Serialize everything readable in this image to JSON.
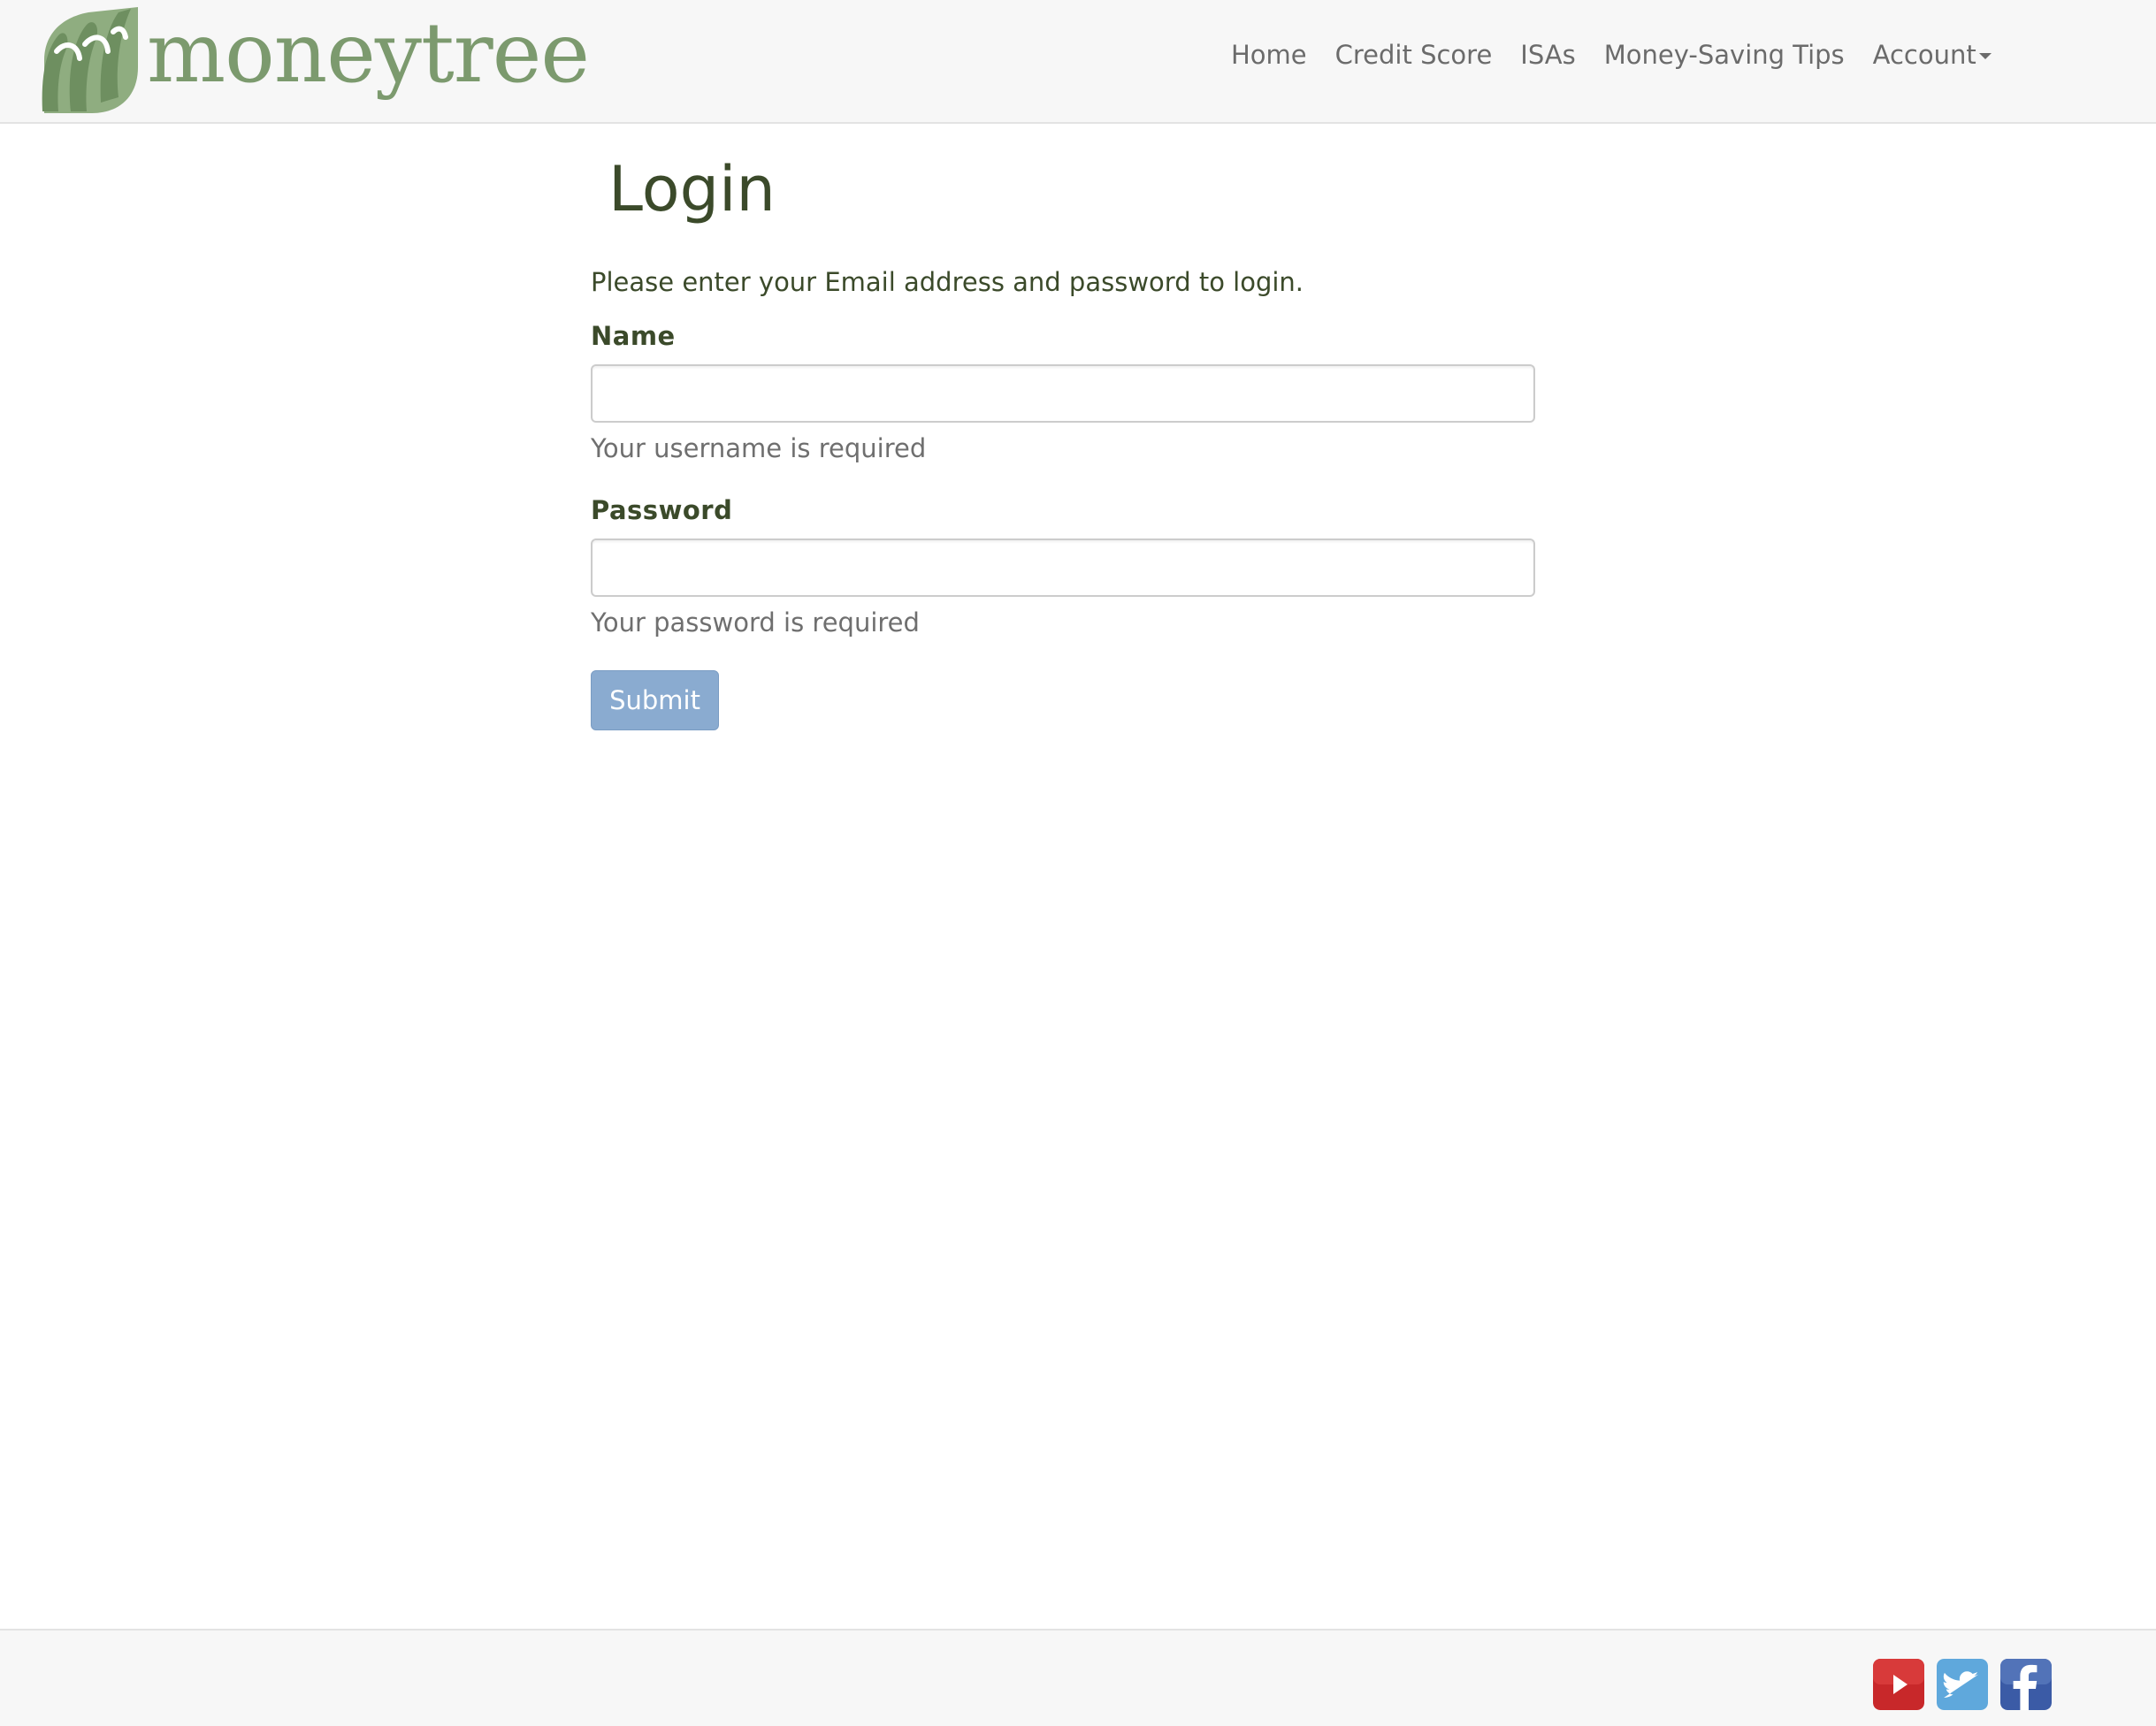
{
  "brand": {
    "name": "moneytree",
    "logo_icon": "moneytree-leaf-logo-icon",
    "color": "#7c9a6e"
  },
  "nav": {
    "items": [
      {
        "label": "Home"
      },
      {
        "label": "Credit Score"
      },
      {
        "label": "ISAs"
      },
      {
        "label": "Money-Saving Tips"
      },
      {
        "label": "Account",
        "dropdown": true
      }
    ]
  },
  "login": {
    "title": "Login",
    "intro": "Please enter your Email address and password to login.",
    "name_field": {
      "label": "Name",
      "value": "",
      "placeholder": "",
      "help": "Your username is required"
    },
    "password_field": {
      "label": "Password",
      "value": "",
      "placeholder": "",
      "help": "Your password is required"
    },
    "submit_label": "Submit",
    "submit_color": "#8aabd0"
  },
  "footer": {
    "social": [
      {
        "icon": "youtube-icon",
        "color": "#c8282a"
      },
      {
        "icon": "twitter-icon",
        "color": "#5fa8dc"
      },
      {
        "icon": "facebook-icon",
        "color": "#3b5ba6"
      }
    ]
  }
}
